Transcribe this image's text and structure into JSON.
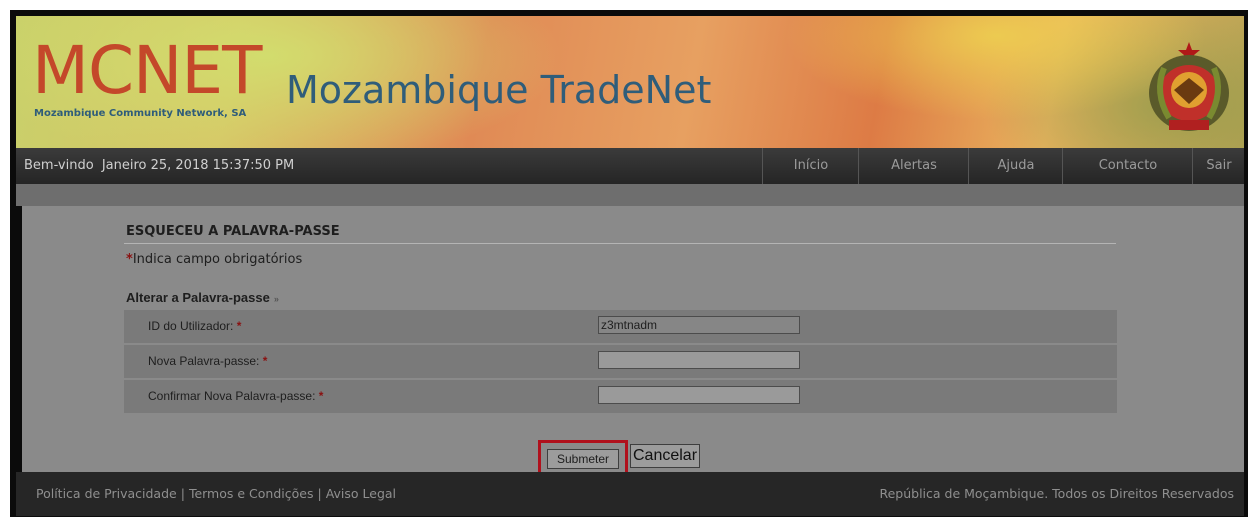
{
  "header": {
    "logo_text": "MCNET",
    "logo_subtitle": "Mozambique Community Network, SA",
    "title": "Mozambique TradeNet"
  },
  "navbar": {
    "welcome": "Bem-vindo",
    "datetime": "Janeiro 25, 2018 15:37:50 PM",
    "items": [
      {
        "label": "Início"
      },
      {
        "label": "Alertas"
      },
      {
        "label": "Ajuda"
      },
      {
        "label": "Contacto"
      },
      {
        "label": "Sair"
      }
    ]
  },
  "page": {
    "heading": "ESQUECEU A PALAVRA-PASSE",
    "required_marker": "*",
    "required_note": "Indica campo obrigatórios",
    "section_label": "Alterar a Palavra-passe",
    "section_chevron": "»"
  },
  "form": {
    "user_id_label": "ID do Utilizador:",
    "user_id_value": "z3mtnadm",
    "new_password_label": "Nova Palavra-passe:",
    "new_password_value": "",
    "confirm_password_label": "Confirmar Nova Palavra-passe:",
    "confirm_password_value": "",
    "required_marker": "*"
  },
  "actions": {
    "submit_label": "Submeter",
    "cancel_label": "Cancelar"
  },
  "footer": {
    "privacy": "Política de Privacidade",
    "terms": "Termos e Condições",
    "legal": "Aviso Legal",
    "separator": "|",
    "copyright": "República de Moçambique. Todos os Direitos Reservados"
  },
  "colors": {
    "logo_red": "#c4482a",
    "logo_blue": "#2f5d7a",
    "highlight_border": "#b0101c",
    "required_red": "#8a1010"
  }
}
